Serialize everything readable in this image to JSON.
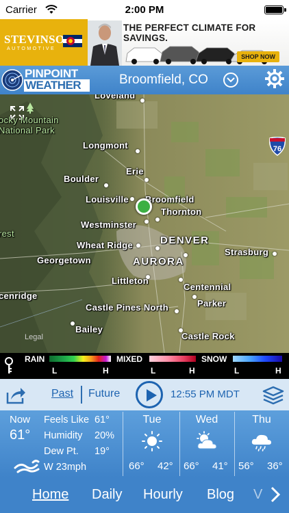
{
  "status_bar": {
    "carrier": "Carrier",
    "time": "2:00 PM"
  },
  "ad": {
    "brand": "STEVINSON",
    "brand_sub": "AUTOMOTIVE",
    "headline": "THE PERFECT CLIMATE FOR SAVINGS.",
    "cta": "SHOP NOW",
    "accent_color": "#e8b20d"
  },
  "header": {
    "logo_line1": "PINPOINT",
    "logo_line2": "WEATHER",
    "location": "Broomfield, CO",
    "bg_color": "#3f83c9"
  },
  "map": {
    "places": {
      "loveland": "Loveland",
      "rocky1": "ocky Mountain",
      "rocky2": "National Park",
      "longmont": "Longmont",
      "erie": "Erie",
      "boulder": "Boulder",
      "louisville": "Louisville",
      "broomfield": "Broomfield",
      "thornton": "Thornton",
      "westminster": "Westminster",
      "forest": "rest",
      "denver": "DENVER",
      "wheat_ridge": "Wheat Ridge",
      "strasburg": "Strasburg",
      "georgetown": "Georgetown",
      "aurora": "AURORA",
      "littleton": "Littleton",
      "centennial": "Centennial",
      "kenridge": "cenridge",
      "parker": "Parker",
      "castle_pines": "Castle Pines North",
      "bailey": "Bailey",
      "castle_rock": "Castle Rock"
    },
    "highway": "76",
    "legal": "Legal"
  },
  "legend": {
    "rain": "RAIN",
    "mixed": "MIXED",
    "snow": "SNOW",
    "low": "L",
    "high": "H"
  },
  "controls": {
    "past": "Past",
    "future": "Future",
    "timestamp": "12:55 PM MDT"
  },
  "current": {
    "label": "Now",
    "temp": "61°",
    "feels_like_label": "Feels Like",
    "feels_like": "61°",
    "humidity_label": "Humidity",
    "humidity": "20%",
    "dew_point_label": "Dew Pt.",
    "dew_point": "19°",
    "wind": "W 23mph"
  },
  "forecast": [
    {
      "day": "Tue",
      "icon": "sun-icon",
      "hi": "66°",
      "lo": "42°"
    },
    {
      "day": "Wed",
      "icon": "partly-cloudy-icon",
      "hi": "66°",
      "lo": "41°"
    },
    {
      "day": "Thu",
      "icon": "rain-cloud-icon",
      "hi": "56°",
      "lo": "36°"
    }
  ],
  "nav": {
    "home": "Home",
    "daily": "Daily",
    "hourly": "Hourly",
    "blog": "Blog",
    "partial": "V"
  }
}
